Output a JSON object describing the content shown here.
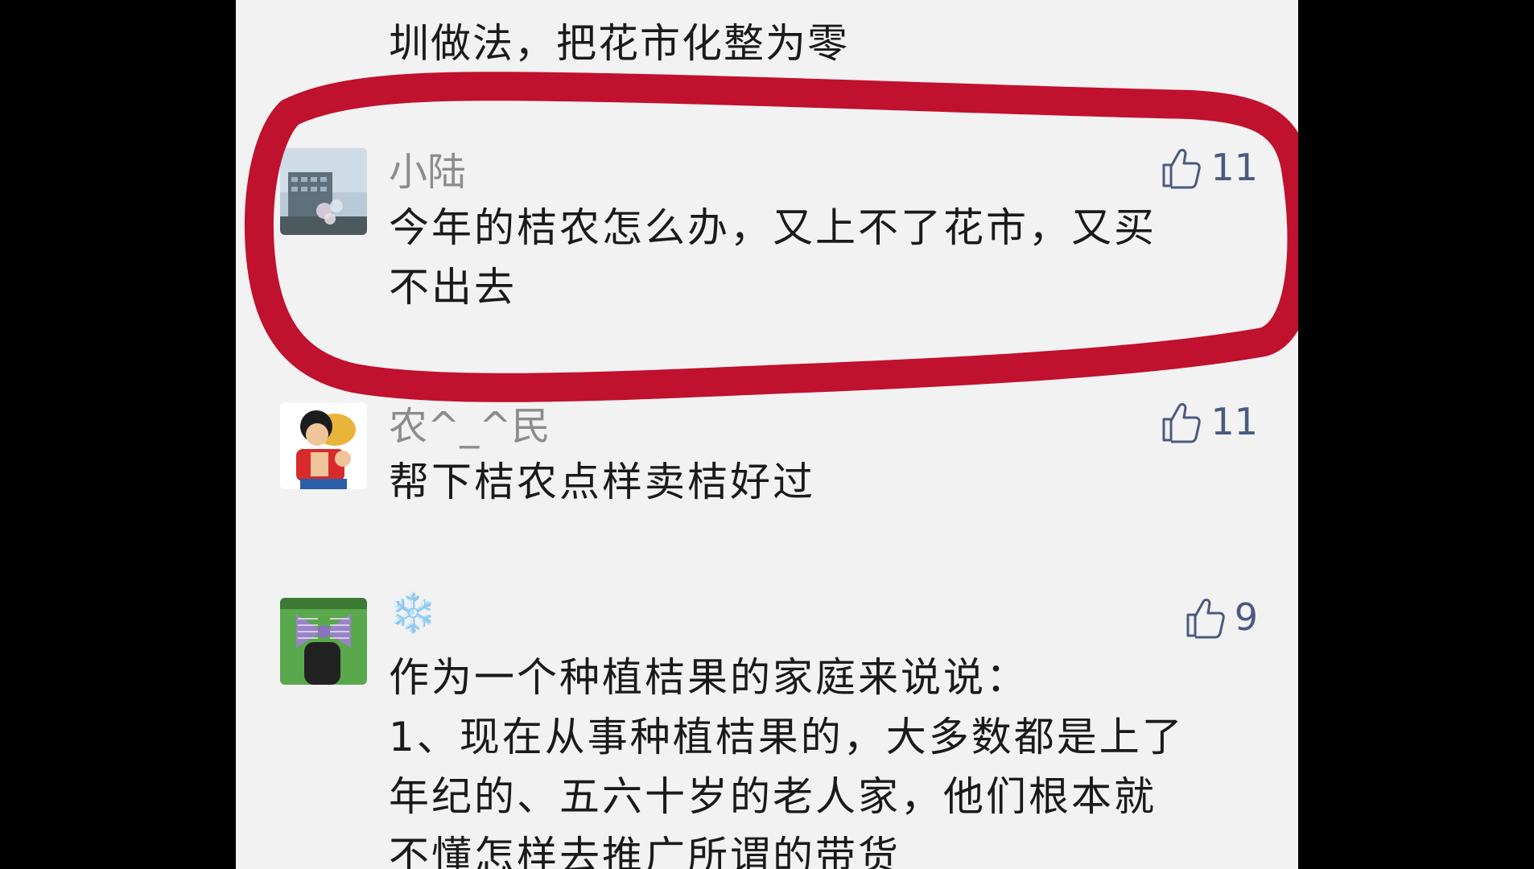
{
  "feed": {
    "prev_comment_tail": "圳做法，把花市化整为零",
    "comments": [
      {
        "username": "小陆",
        "likes": "11",
        "text_lines": [
          "今年的桔农怎么办，又上不了花市，又买",
          "不出去"
        ],
        "avatar": "building-photo-avatar",
        "highlighted": true
      },
      {
        "username": "农^_^民",
        "likes": "11",
        "text_lines": [
          "帮下桔农点样卖桔好过"
        ],
        "avatar": "cartoon-character-avatar",
        "highlighted": false
      },
      {
        "username": "❄️",
        "likes": "9",
        "text_lines": [
          "作为一个种植桔果的家庭来说说：",
          "1、现在从事种植桔果的，大多数都是上了",
          "年纪的、五六十岁的老人家，他们根本就",
          "不懂怎样去推广所谓的带货"
        ],
        "avatar": "purple-bow-avatar",
        "highlighted": false
      }
    ]
  },
  "colors": {
    "panel_bg": "#f2f2f2",
    "highlight_ring": "#c0112f",
    "like_icon": "#4a5a80",
    "username": "#8c8c8c",
    "body_text": "#1a1a1a"
  },
  "icons": {
    "like": "thumbs-up-icon",
    "snowflake": "snowflake-emoji"
  }
}
